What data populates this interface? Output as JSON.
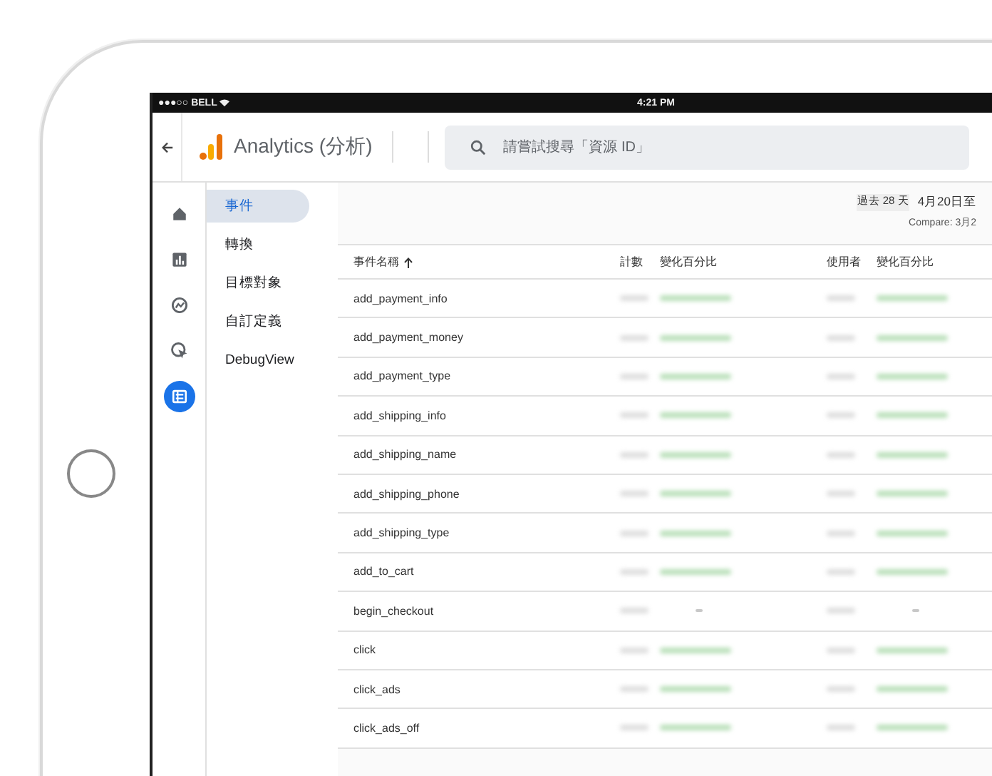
{
  "status_bar": {
    "carrier": "●●●○○ BELL",
    "time": "4:21 PM"
  },
  "header": {
    "title": "Analytics (分析)",
    "search": {
      "placeholder": "請嘗試搜尋「資源 ID」"
    }
  },
  "rail": [
    {
      "kind": "home",
      "selected": false
    },
    {
      "kind": "reports",
      "selected": false
    },
    {
      "kind": "explore",
      "selected": false
    },
    {
      "kind": "advertising",
      "selected": false
    },
    {
      "kind": "configure",
      "selected": true
    }
  ],
  "nav": [
    {
      "label": "事件",
      "selected": true
    },
    {
      "label": "轉換",
      "selected": false
    },
    {
      "label": "目標對象",
      "selected": false
    },
    {
      "label": "自訂定義",
      "selected": false
    },
    {
      "label": "DebugView",
      "selected": false
    }
  ],
  "date_range": {
    "range": "過去 28 天",
    "dates": "4月20日至",
    "compare": "Compare: 3月2"
  },
  "table": {
    "columns": [
      {
        "label": "事件名稱",
        "sorted": true
      },
      {
        "label": "計數",
        "sorted": false
      },
      {
        "label": "變化百分比",
        "sorted": false
      },
      {
        "label": "使用者",
        "sorted": false
      },
      {
        "label": "變化百分比",
        "sorted": false
      }
    ],
    "rows": [
      {
        "name": "add_payment_info",
        "kind": "change"
      },
      {
        "name": "add_payment_money",
        "kind": "change"
      },
      {
        "name": "add_payment_type",
        "kind": "change"
      },
      {
        "name": "add_shipping_info",
        "kind": "change"
      },
      {
        "name": "add_shipping_name",
        "kind": "change"
      },
      {
        "name": "add_shipping_phone",
        "kind": "change"
      },
      {
        "name": "add_shipping_type",
        "kind": "change"
      },
      {
        "name": "add_to_cart",
        "kind": "change"
      },
      {
        "name": "begin_checkout",
        "kind": "flat"
      },
      {
        "name": "click",
        "kind": "change"
      },
      {
        "name": "click_ads",
        "kind": "change"
      },
      {
        "name": "click_ads_off",
        "kind": "change"
      }
    ]
  }
}
